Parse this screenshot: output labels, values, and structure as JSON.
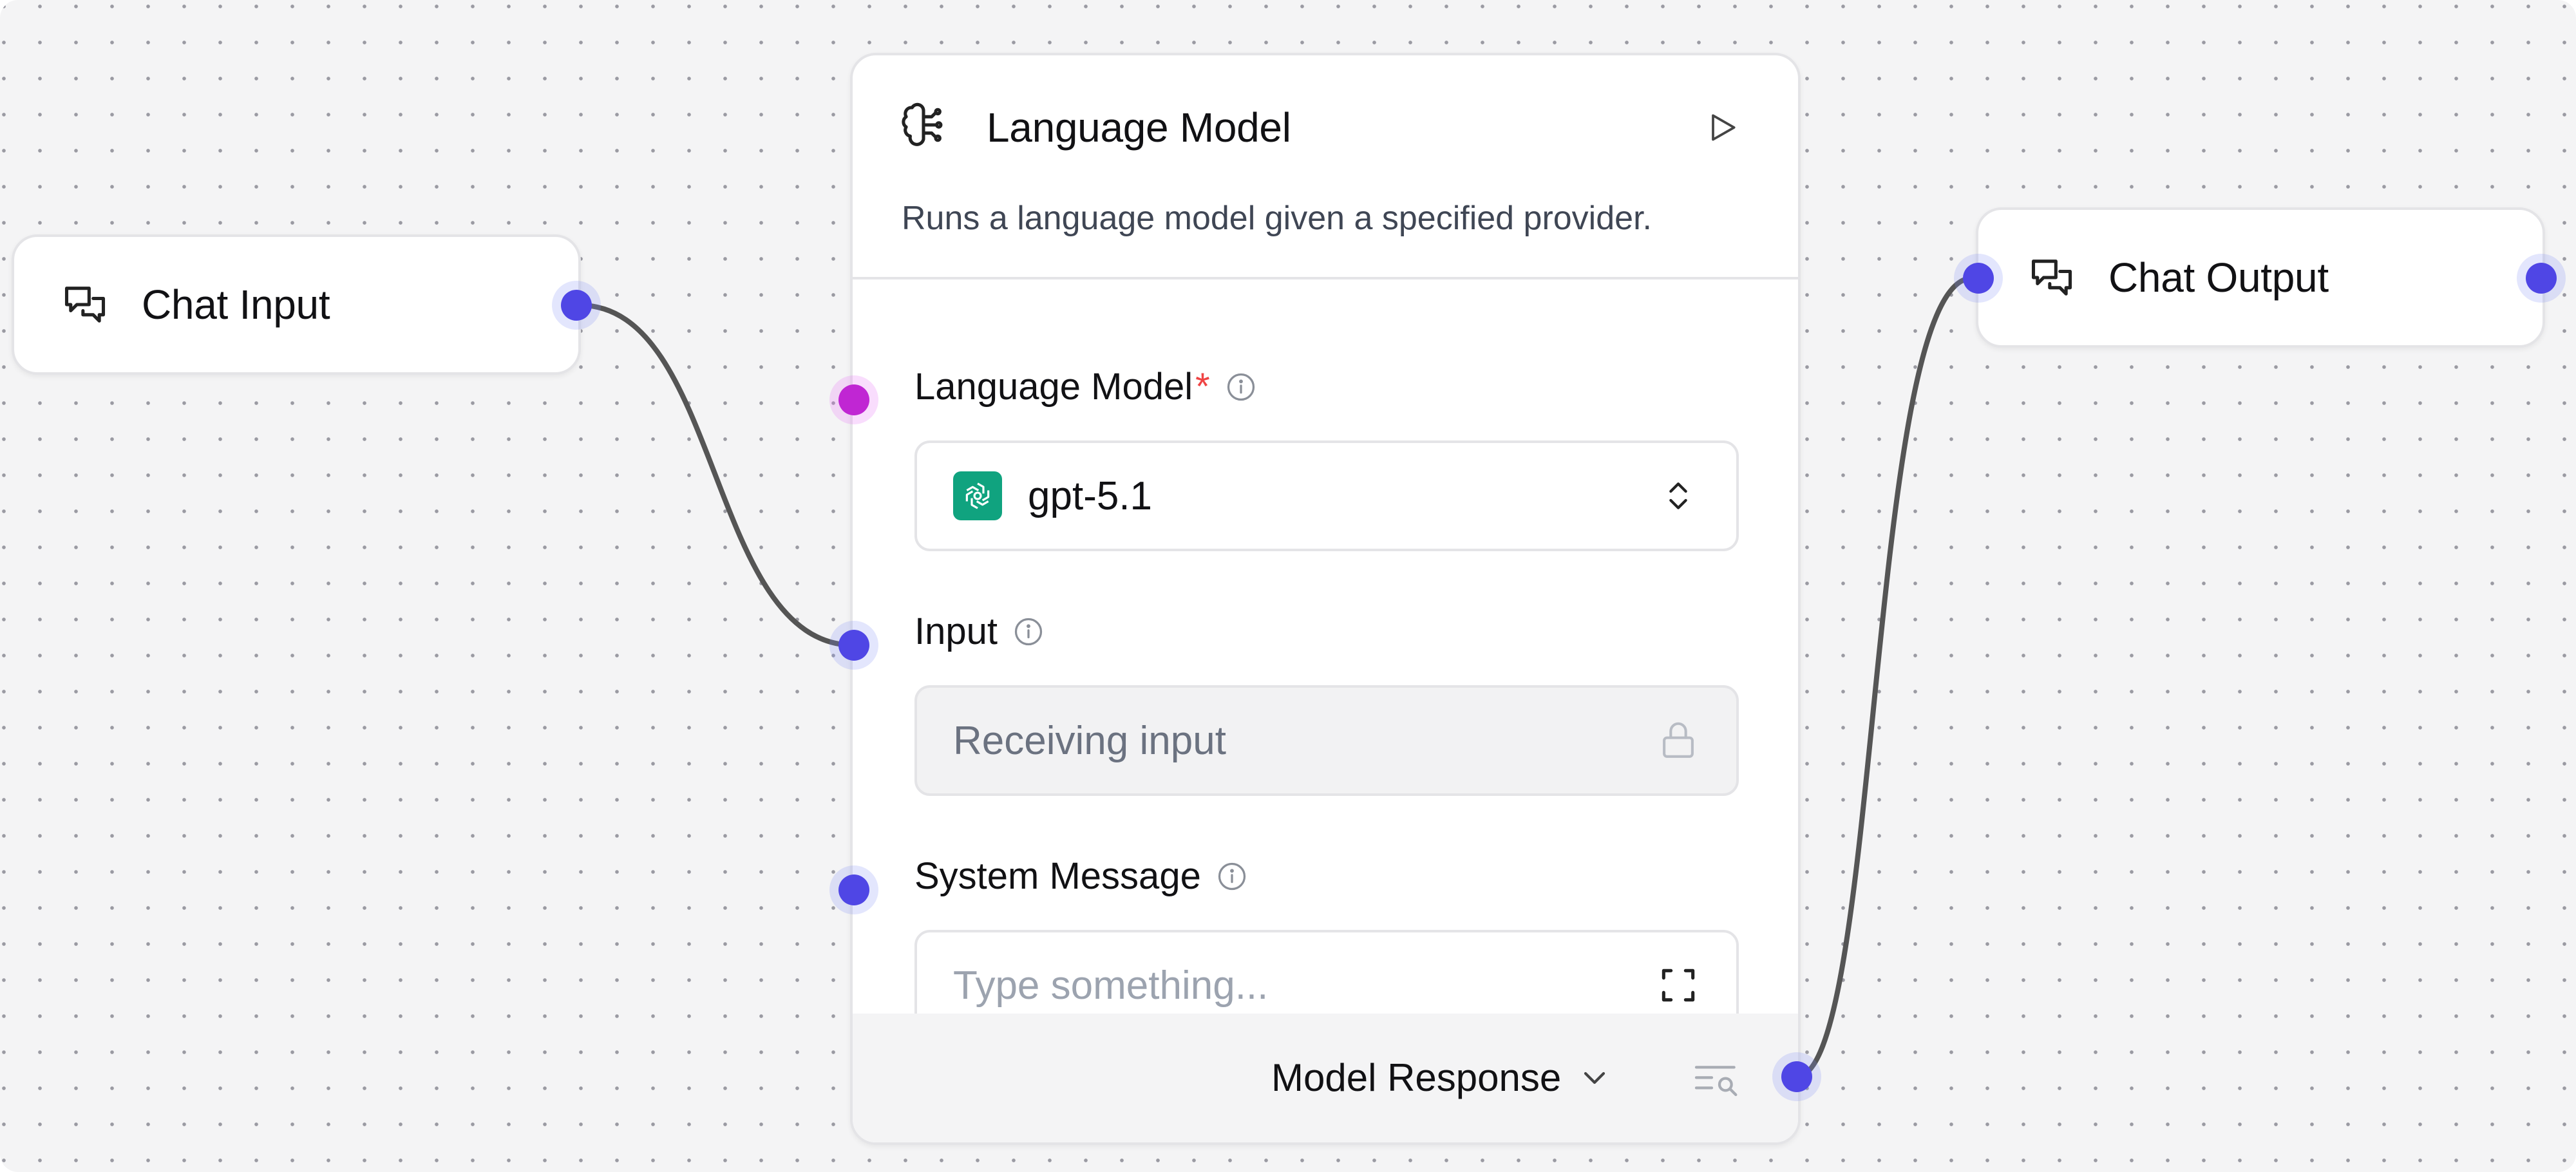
{
  "nodes": {
    "chat_input": {
      "title": "Chat Input",
      "icon": "messages-icon"
    },
    "language_model": {
      "title": "Language Model",
      "icon": "brain-circuit-icon",
      "run_icon": "play-icon",
      "description": "Runs a language model given a specified provider.",
      "fields": {
        "model": {
          "label": "Language Model",
          "required_mark": "*",
          "value": "gpt-5.1",
          "provider_icon": "openai-icon",
          "trail_icon": "chevrons-up-down-icon"
        },
        "input": {
          "label": "Input",
          "placeholder": "Receiving input",
          "trail_icon": "lock-icon"
        },
        "system_message": {
          "label": "System Message",
          "placeholder": "Type something...",
          "trail_icon": "expand-icon"
        }
      },
      "output": {
        "label": "Model Response",
        "dropdown_icon": "chevron-down-icon",
        "inspect_icon": "text-search-icon"
      }
    },
    "chat_output": {
      "title": "Chat Output",
      "icon": "messages-icon"
    }
  },
  "colors": {
    "handle": "#4f46e5",
    "handle_model": "#c026d3",
    "edge": "#555555",
    "required": "#ef4444",
    "openai": "#10a37f"
  }
}
